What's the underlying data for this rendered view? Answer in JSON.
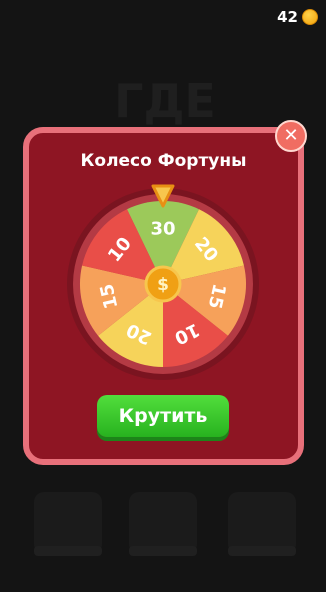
{
  "header": {
    "coin_count": "42",
    "coin_icon": "coin-icon"
  },
  "background": {
    "title": "ГДЕ"
  },
  "modal": {
    "title": "Колесо Фортуны",
    "close_icon": "close-icon",
    "spin_label": "Крутить",
    "colors": {
      "panel": "#8e1523",
      "border": "#e8707a",
      "spin_button": "#3cc42b"
    }
  },
  "wheel": {
    "pointer_icon": "pointer-triangle-icon",
    "center_icon": "dollar-coin-icon",
    "center_symbol": "$",
    "segments": [
      {
        "label": "30",
        "color": "#9cc95a"
      },
      {
        "label": "20",
        "color": "#f6d35a"
      },
      {
        "label": "15",
        "color": "#f6a15a"
      },
      {
        "label": "10",
        "color": "#e94e48"
      },
      {
        "label": "20",
        "color": "#f6d35a"
      },
      {
        "label": "15",
        "color": "#f6a15a"
      },
      {
        "label": "10",
        "color": "#e94e48"
      }
    ]
  }
}
